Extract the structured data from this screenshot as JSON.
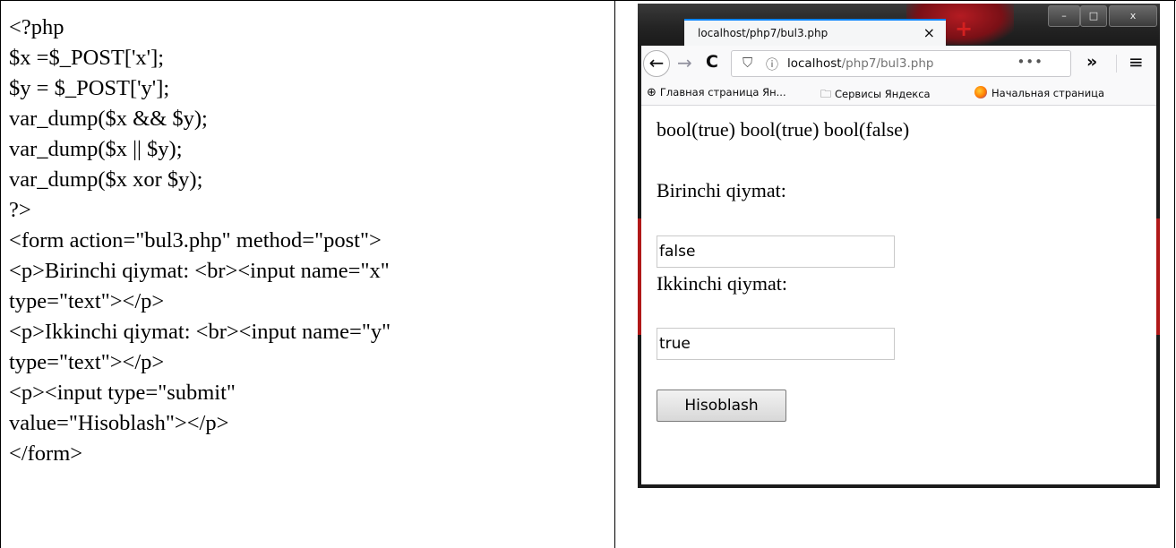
{
  "code_lines": [
    "<?php",
    "$x =$_POST['x'];",
    "$y = $_POST['y'];",
    "var_dump($x && $y);",
    "var_dump($x || $y);",
    "var_dump($x xor $y);",
    "?>",
    "<form action=\"bul3.php\" method=\"post\">",
    "<p>Birinchi qiymat: <br><input name=\"x\"",
    "type=\"text\"></p>",
    "<p>Ikkinchi qiymat: <br><input name=\"y\"",
    "type=\"text\"></p>",
    "<p><input type=\"submit\"",
    "value=\"Hisoblash\"></p>",
    "</form>"
  ],
  "browser": {
    "tab_title": "localhost/php7/bul3.php",
    "tab_close": "×",
    "new_tab": "+",
    "window_buttons": {
      "minimize": "–",
      "maximize": "□",
      "close": "x"
    },
    "nav": {
      "back": "←",
      "forward": "→",
      "reload": "C",
      "overflow": "»",
      "menu": "≡"
    },
    "url": {
      "host": "localhost",
      "path": "/php7/bul3.php",
      "page_actions": "•••"
    },
    "bookmarks": [
      {
        "label": "Главная страница Ян...",
        "icon": "globe-icon"
      },
      {
        "label": "Сервисы Яндекса",
        "icon": "folder-icon"
      },
      {
        "label": "Начальная страница",
        "icon": "firefox-icon"
      }
    ],
    "page": {
      "result_text": "bool(true) bool(true) bool(false)",
      "label_x": "Birinchi qiymat:",
      "value_x": "false",
      "label_y": "Ikkinchi qiymat:",
      "value_y": "true",
      "submit_label": "Hisoblash"
    }
  }
}
